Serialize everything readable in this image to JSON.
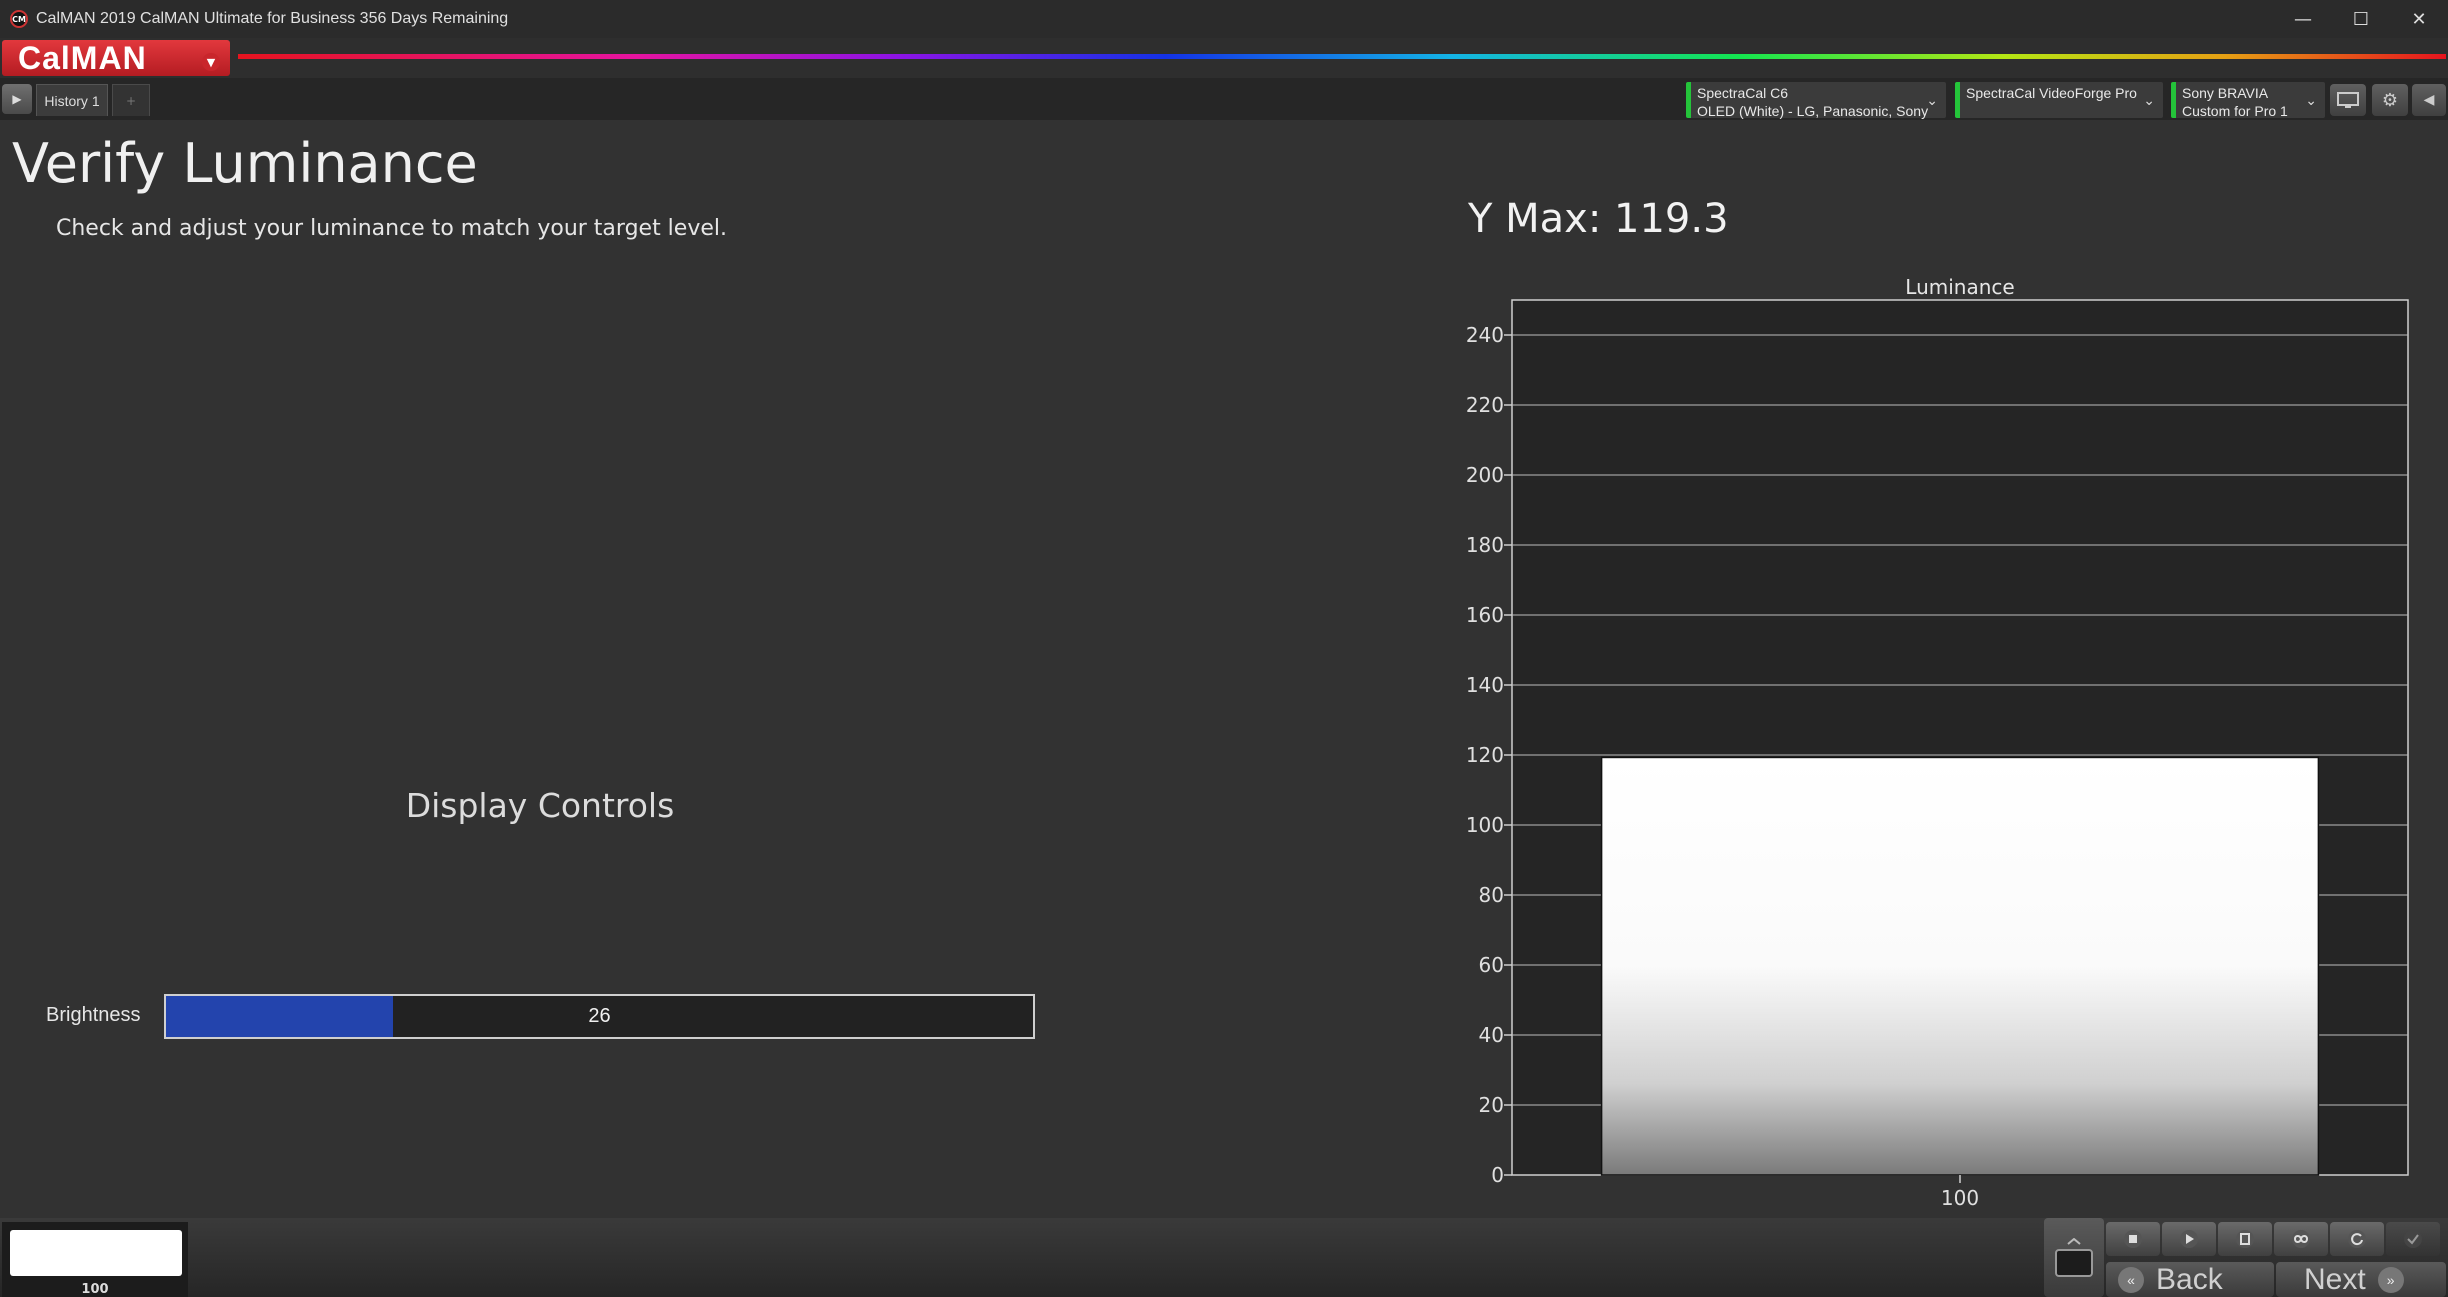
{
  "window": {
    "icon_text": "CM",
    "title": "CalMAN 2019 CalMAN Ultimate for Business 356 Days Remaining",
    "minimize": "—",
    "maximize": "☐",
    "close": "✕"
  },
  "brand": {
    "logo": "CalMAN",
    "logo_arrow": "▼"
  },
  "tabs": {
    "play": "▶",
    "history_label": "History 1",
    "add": "+"
  },
  "devices": {
    "meter": {
      "line1": "SpectraCal C6",
      "line2": "OLED (White) - LG, Panasonic, Sony"
    },
    "source": {
      "line1": "SpectraCal VideoForge Pro",
      "line2": ""
    },
    "display": {
      "line1": "Sony BRAVIA",
      "line2": "Custom for Pro 1"
    },
    "chevron": "⌄",
    "gear": "⚙",
    "arrow_left": "◀"
  },
  "main": {
    "title": "Verify Luminance",
    "instructions": "Check and adjust your luminance to match your target level.",
    "controls_title": "Display Controls",
    "brightness": {
      "label": "Brightness",
      "value": 26,
      "display_value": "26",
      "fill_fraction": 0.262
    },
    "ymax_text": "Y Max: 119.3"
  },
  "chart_data": {
    "type": "bar",
    "title": "Luminance",
    "categories": [
      "100"
    ],
    "values": [
      119.3
    ],
    "ylim": [
      0,
      250
    ],
    "yticks": [
      0,
      20,
      40,
      60,
      80,
      100,
      120,
      140,
      160,
      180,
      200,
      220,
      240
    ],
    "grid": true,
    "bar_color": "#ffffff"
  },
  "bottom": {
    "swatch_label": "100",
    "swatch_color": "#ffffff",
    "back_label": "Back",
    "next_label": "Next"
  },
  "colors": {
    "accent_red": "#d62a30",
    "status_green": "#24c43a",
    "slider_fill": "#2344ad"
  }
}
